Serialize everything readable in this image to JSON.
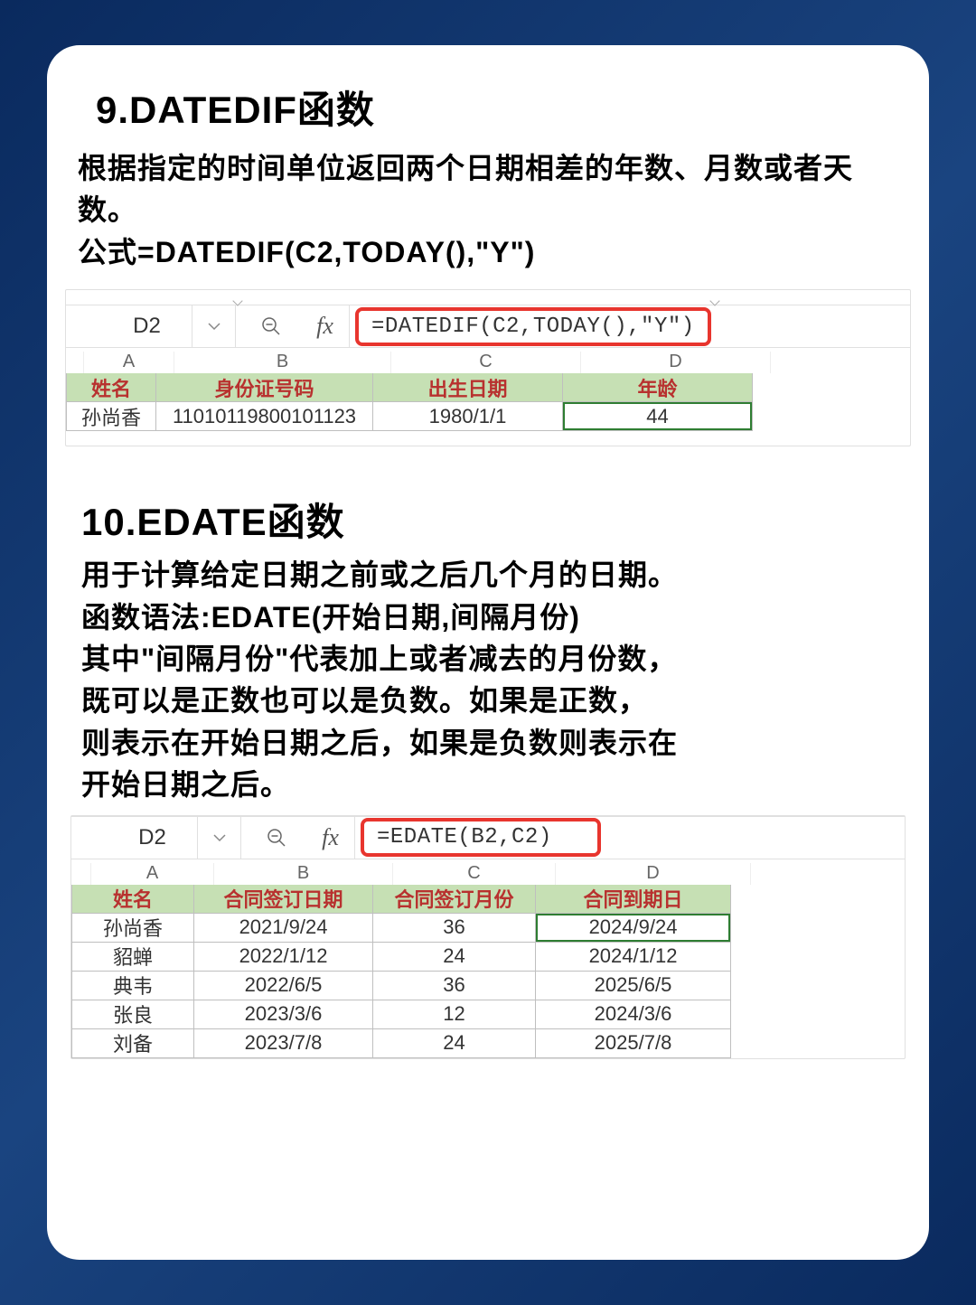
{
  "section1": {
    "title": "9.DATEDIF函数",
    "desc_line1": "根据指定的时间单位返回两个日期相差的年数、月数或者天数。",
    "desc_line2": "公式=DATEDIF(C2,TODAY(),\"Y\")",
    "cell_ref": "D2",
    "fx": "fx",
    "formula": "=DATEDIF(C2,TODAY(),\"Y\")",
    "col_headers": {
      "A": "A",
      "B": "B",
      "C": "C",
      "D": "D"
    },
    "headers": {
      "A": "姓名",
      "B": "身份证号码",
      "C": "出生日期",
      "D": "年龄"
    },
    "rows": [
      {
        "A": "孙尚香",
        "B": "11010119800101123",
        "C": "1980/1/1",
        "D": "44"
      }
    ]
  },
  "section2": {
    "title": "10.EDATE函数",
    "desc_line1": "用于计算给定日期之前或之后几个月的日期。",
    "desc_line2": "函数语法:EDATE(开始日期,间隔月份)",
    "desc_line3": "其中\"间隔月份\"代表加上或者减去的月份数，",
    "desc_line4": "既可以是正数也可以是负数。如果是正数，",
    "desc_line5": "则表示在开始日期之后，如果是负数则表示在",
    "desc_line6": "开始日期之后。",
    "cell_ref": "D2",
    "fx": "fx",
    "formula": "=EDATE(B2,C2)",
    "col_headers": {
      "A": "A",
      "B": "B",
      "C": "C",
      "D": "D"
    },
    "headers": {
      "A": "姓名",
      "B": "合同签订日期",
      "C": "合同签订月份",
      "D": "合同到期日"
    },
    "rows": [
      {
        "A": "孙尚香",
        "B": "2021/9/24",
        "C": "36",
        "D": "2024/9/24"
      },
      {
        "A": "貂蝉",
        "B": "2022/1/12",
        "C": "24",
        "D": "2024/1/12"
      },
      {
        "A": "典韦",
        "B": "2022/6/5",
        "C": "36",
        "D": "2025/6/5"
      },
      {
        "A": "张良",
        "B": "2023/3/6",
        "C": "12",
        "D": "2024/3/6"
      },
      {
        "A": "刘备",
        "B": "2023/7/8",
        "C": "24",
        "D": "2025/7/8"
      }
    ]
  }
}
